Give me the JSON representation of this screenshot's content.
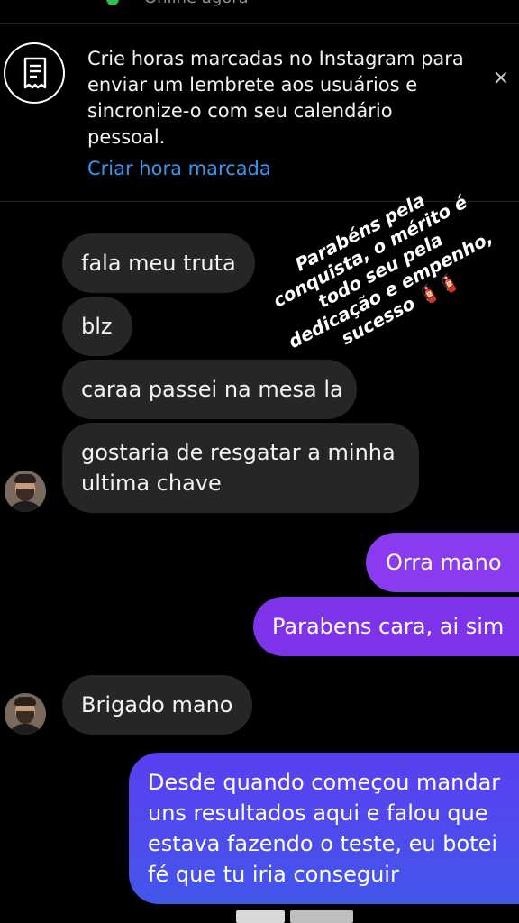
{
  "header": {
    "status_text": "Online agora"
  },
  "prompt": {
    "text": "Crie horas marcadas no Instagram para enviar um lembrete aos usuários e sincronize-o com seu calendário pessoal.",
    "link_label": "Criar hora marcada",
    "close_glyph": "×",
    "icon": "receipt-icon"
  },
  "messages": [
    {
      "from": "them",
      "text": "fala meu truta"
    },
    {
      "from": "them",
      "text": "blz"
    },
    {
      "from": "them",
      "text": "caraa passei na mesa la"
    },
    {
      "from": "them",
      "lines": [
        "gostaria de resgatar a minha",
        "ultima chave"
      ]
    },
    {
      "from": "me",
      "text": "Orra mano"
    },
    {
      "from": "me",
      "text": "Parabens cara, ai sim"
    },
    {
      "from": "them",
      "text": "Brigado mano"
    },
    {
      "from": "me",
      "lines": [
        "Desde quando começou mandar",
        "uns resultados aqui e falou que",
        "estava fazendo o teste, eu botei",
        "fé que tu iria conseguir"
      ]
    }
  ],
  "sticker": {
    "text": "Parabéns pela conquista, o mérito é todo seu pela dedicação e empenho, sucesso",
    "emoji": "🧯🧯"
  },
  "colors": {
    "incoming_bubble": "#262626",
    "outgoing_purple": "#7a2fe0",
    "outgoing_blue": "#4a55e8",
    "link": "#3797f0"
  }
}
